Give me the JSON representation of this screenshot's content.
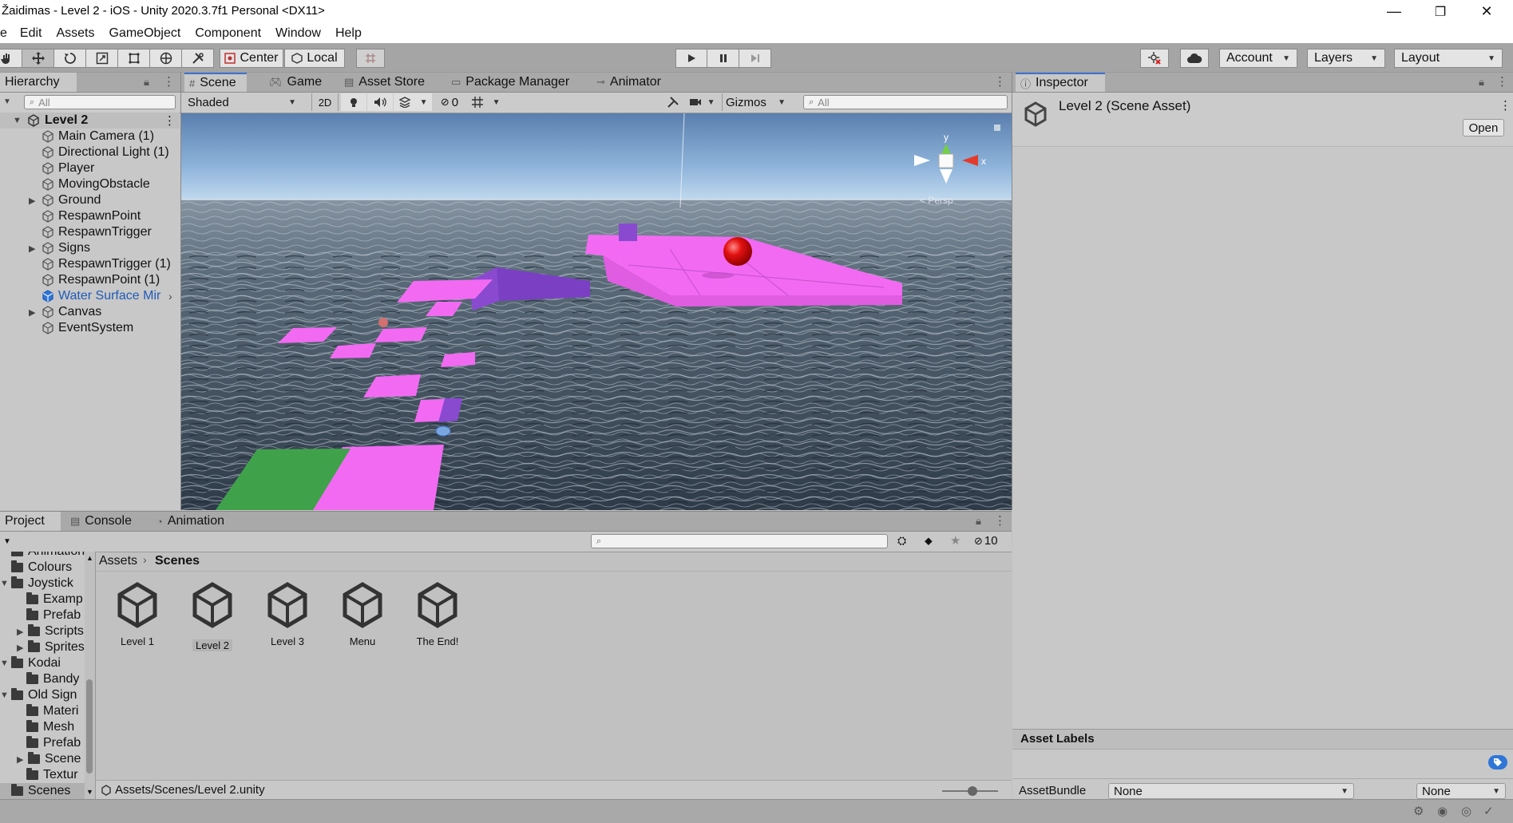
{
  "window": {
    "title": "Žaidimas - Level 2 - iOS - Unity 2020.3.7f1 Personal <DX11>",
    "minimize": "—",
    "restore": "❐",
    "close": "✕"
  },
  "menu": [
    "e",
    "Edit",
    "Assets",
    "GameObject",
    "Component",
    "Window",
    "Help"
  ],
  "toolbar": {
    "pivot_label": "Center",
    "space_label": "Local",
    "account_label": "Account",
    "layers_label": "Layers",
    "layout_label": "Layout"
  },
  "hierarchy": {
    "tab_label": "Hierarchy",
    "search_placeholder": "All",
    "scene_name": "Level 2",
    "items": [
      {
        "label": "Main Camera (1)",
        "foldable": false
      },
      {
        "label": "Directional Light (1)",
        "foldable": false
      },
      {
        "label": "Player",
        "foldable": false
      },
      {
        "label": "MovingObstacle",
        "foldable": false
      },
      {
        "label": "Ground",
        "foldable": true
      },
      {
        "label": "RespawnPoint",
        "foldable": false
      },
      {
        "label": "RespawnTrigger",
        "foldable": false
      },
      {
        "label": "Signs",
        "foldable": true
      },
      {
        "label": "RespawnTrigger (1)",
        "foldable": false
      },
      {
        "label": "RespawnPoint (1)",
        "foldable": false
      },
      {
        "label": "Water Surface Mir",
        "foldable": false,
        "prefab": true
      },
      {
        "label": "Canvas",
        "foldable": true
      },
      {
        "label": "EventSystem",
        "foldable": false
      }
    ]
  },
  "scene": {
    "tabs": [
      "Scene",
      "Game",
      "Asset Store",
      "Package Manager",
      "Animator"
    ],
    "shading_mode": "Shaded",
    "mode_2d": "2D",
    "hidden_count": "0",
    "gizmos_label": "Gizmos",
    "search_placeholder": "All",
    "gizmo_y": "y",
    "gizmo_x": "x",
    "projection": "< Persp"
  },
  "inspector": {
    "tab_label": "Inspector",
    "asset_title": "Level 2 (Scene Asset)",
    "open_button": "Open",
    "asset_labels_title": "Asset Labels",
    "assetbundle_label": "AssetBundle",
    "assetbundle_value": "None",
    "variant_value": "None"
  },
  "project": {
    "tabs": [
      "Project",
      "Console",
      "Animation"
    ],
    "hidden_count": "10",
    "breadcrumb_root": "Assets",
    "breadcrumb_current": "Scenes",
    "tree": [
      {
        "label": "Animation",
        "depth": 1,
        "fold": ""
      },
      {
        "label": "Colours",
        "depth": 1,
        "fold": ""
      },
      {
        "label": "Joystick",
        "depth": 0,
        "fold": "open"
      },
      {
        "label": "Examp",
        "depth": 2,
        "fold": ""
      },
      {
        "label": "Prefab",
        "depth": 2,
        "fold": ""
      },
      {
        "label": "Scripts",
        "depth": 1,
        "fold": "closed",
        "indent": 2
      },
      {
        "label": "Sprites",
        "depth": 1,
        "fold": "closed",
        "indent": 2
      },
      {
        "label": "Kodai",
        "depth": 0,
        "fold": "open"
      },
      {
        "label": "Bandy",
        "depth": 2,
        "fold": ""
      },
      {
        "label": "Old Sign",
        "depth": 0,
        "fold": "open"
      },
      {
        "label": "Materi",
        "depth": 2,
        "fold": ""
      },
      {
        "label": "Mesh",
        "depth": 2,
        "fold": ""
      },
      {
        "label": "Prefab",
        "depth": 2,
        "fold": ""
      },
      {
        "label": "Scene",
        "depth": 1,
        "fold": "closed",
        "indent": 2
      },
      {
        "label": "Textur",
        "depth": 2,
        "fold": ""
      },
      {
        "label": "Scenes",
        "depth": 0,
        "fold": "",
        "selected": true
      }
    ],
    "assets": [
      {
        "name": "Level 1",
        "selected": false
      },
      {
        "name": "Level 2",
        "selected": true
      },
      {
        "name": "Level 3",
        "selected": false
      },
      {
        "name": "Menu",
        "selected": false
      },
      {
        "name": "The End!",
        "selected": false
      }
    ],
    "footer_path": "Assets/Scenes/Level 2.unity",
    "icon_zoom": 0.45
  },
  "colors": {
    "platform_magenta": "#f26af2",
    "platform_purple": "#8a4ad0",
    "ground_green": "#3fa24a",
    "ball_red": "#e31010",
    "selection_blue": "#3a72d0"
  }
}
